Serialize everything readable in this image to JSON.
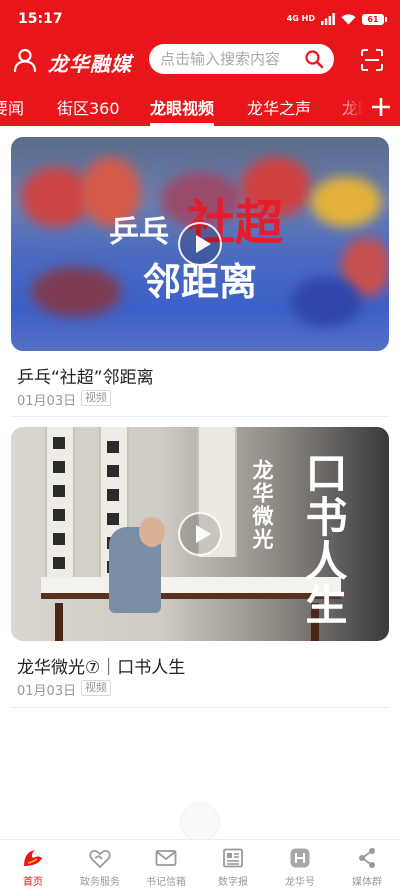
{
  "status_bar": {
    "time": "15:17",
    "network": "4G HD",
    "battery": "61"
  },
  "header": {
    "logo": "龙华融媒",
    "search_placeholder": "点击输入搜索内容"
  },
  "tabs": [
    {
      "label": "要闻",
      "active": false
    },
    {
      "label": "街区360",
      "active": false
    },
    {
      "label": "龙眼视频",
      "active": true
    },
    {
      "label": "龙华之声",
      "active": false
    },
    {
      "label": "龙眼",
      "active": false
    }
  ],
  "cards": [
    {
      "title": "乒乓“社超”邻距离",
      "date": "01月03日",
      "tag": "视频",
      "overlay": {
        "line1a": "乒乓",
        "line1b": "社超",
        "line2": "邻距离"
      }
    },
    {
      "title": "龙华微光⑦｜口书人生",
      "date": "01月03日",
      "tag": "视频",
      "overlay": {
        "series": "龙华微光",
        "title": "口书人生"
      }
    }
  ],
  "bottom_nav": [
    {
      "label": "首页",
      "icon": "home-logo-icon",
      "active": true
    },
    {
      "label": "政务服务",
      "icon": "heart-service-icon",
      "active": false
    },
    {
      "label": "书记信箱",
      "icon": "mail-icon",
      "active": false
    },
    {
      "label": "数字报",
      "icon": "newspaper-icon",
      "active": false
    },
    {
      "label": "龙华号",
      "icon": "longhua-account-icon",
      "active": false
    },
    {
      "label": "媒体群",
      "icon": "share-nodes-icon",
      "active": false
    }
  ],
  "colors": {
    "brand_red": "#e8161b",
    "text_dark": "#222222",
    "text_gray": "#999999"
  }
}
